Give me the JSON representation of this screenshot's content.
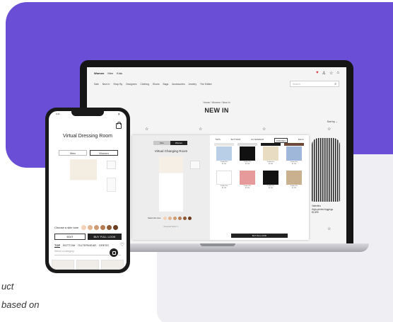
{
  "tagline": [
    "uct",
    "based on"
  ],
  "site": {
    "brands": [
      "Women",
      "Men",
      "Kids"
    ],
    "categories": [
      "Sale",
      "New In",
      "Shop By",
      "Designers",
      "Clothing",
      "Shoes",
      "Bags",
      "Accessories",
      "Jewelry",
      "The Edited"
    ],
    "search_placeholder": "Search",
    "breadcrumb": "Home / Women / New In",
    "page_title": "NEW IN",
    "sort_label": "Sort by",
    "side_product_text": [
      "Valentino",
      "High-printed leggings",
      "$1,890"
    ]
  },
  "modal": {
    "toggle_men": "Men",
    "toggle_women": "Women",
    "title": "Virtual Changing Room",
    "skin_label": "Select skin tone",
    "personal_label": "Personal Stylist",
    "tabs": [
      "TOPS",
      "BOTTOMS",
      "OUTERWEAR",
      "DRESSES",
      "BAGS"
    ],
    "active_tab": "DRESSES",
    "items": [
      {
        "cap": "Product Pro",
        "price": "$1,250"
      },
      {
        "cap": "Product Pro",
        "price": "$1,250"
      },
      {
        "cap": "Product Pro",
        "price": "$1,250"
      },
      {
        "cap": "Product Pro",
        "price": "$1,250"
      },
      {
        "cap": "Product Pro",
        "price": "$1,250"
      },
      {
        "cap": "Product Pro",
        "price": "$1,250"
      },
      {
        "cap": "Product Pro",
        "price": "$1,250"
      },
      {
        "cap": "Product Pro",
        "price": "$1,250"
      }
    ],
    "buy_label": "BUY FULL LOOK"
  },
  "phone": {
    "time": "9:41",
    "title": "Virtual Dressing Room",
    "gender_men": "Men",
    "gender_women": "Women",
    "skin_label": "Choose a skin tone",
    "edit_label": "EDIT",
    "buy_label": "BUY FULL LOOK",
    "tabs": [
      "TOP",
      "BOTTOM",
      "OUTERWEAR",
      "DRESS"
    ],
    "category_placeholder": "Select a category"
  },
  "colors": {
    "purple": "#6a4fd6",
    "skin_tones": [
      "#f1d2b6",
      "#e2b48f",
      "#cf9b72",
      "#b67b52",
      "#8f5a36",
      "#6b3e22"
    ],
    "modal_thumbs": [
      "#b9cfe8",
      "#111111",
      "#e8dcc3",
      "#9fb8d9",
      "#ffffff",
      "#e79a9a",
      "#121212",
      "#c9b08f"
    ]
  }
}
